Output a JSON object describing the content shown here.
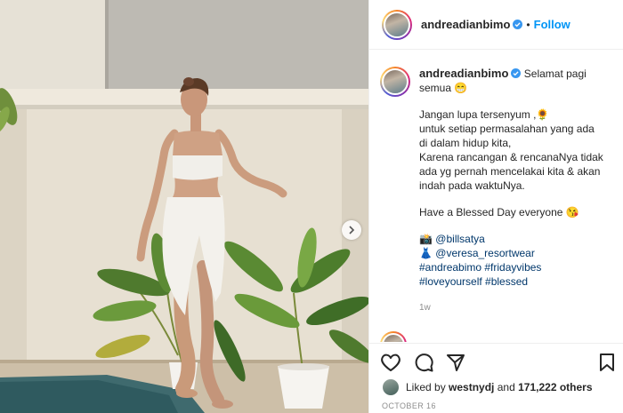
{
  "post": {
    "username": "andreadianbimo",
    "follow_label": "Follow",
    "separator": "•"
  },
  "caption": {
    "first_line_a": "Selamat pagi",
    "first_line_b": "semua",
    "emoji_grin": "😁",
    "line1": "Jangan lupa tersenyum ,",
    "emoji_flower": "🌻",
    "line2": "untuk setiap permasalahan yang ada",
    "line3": "di dalam hidup kita,",
    "line4": "Karena rancangan & rencanaNya tidak",
    "line5": "ada yg pernah mencelakai kita & akan",
    "line6": "indah pada waktuNya.",
    "line7": "Have a Blessed Day everyone",
    "emoji_kiss": "😘",
    "emoji_camera": "📸",
    "credit1": "@billsatya",
    "emoji_dress": "👗",
    "credit2": "@veresa_resortwear",
    "tags1": "#andreabimo #fridayvibes",
    "tags2": "#loveyourself #blessed",
    "time_ago": "1w"
  },
  "likes": {
    "prefix": "Liked by ",
    "user": "westnydj",
    "middle": " and ",
    "count": "171,222 others"
  },
  "date": "OCTOBER 16",
  "icons": [
    "heart-icon",
    "comment-icon",
    "share-icon",
    "bookmark-icon",
    "verified-badge-icon",
    "chevron-right-icon"
  ],
  "colors": {
    "link_blue": "#0095f6",
    "hashtag": "#00376b",
    "verified": "#3897f0",
    "muted": "#8e8e8e"
  }
}
